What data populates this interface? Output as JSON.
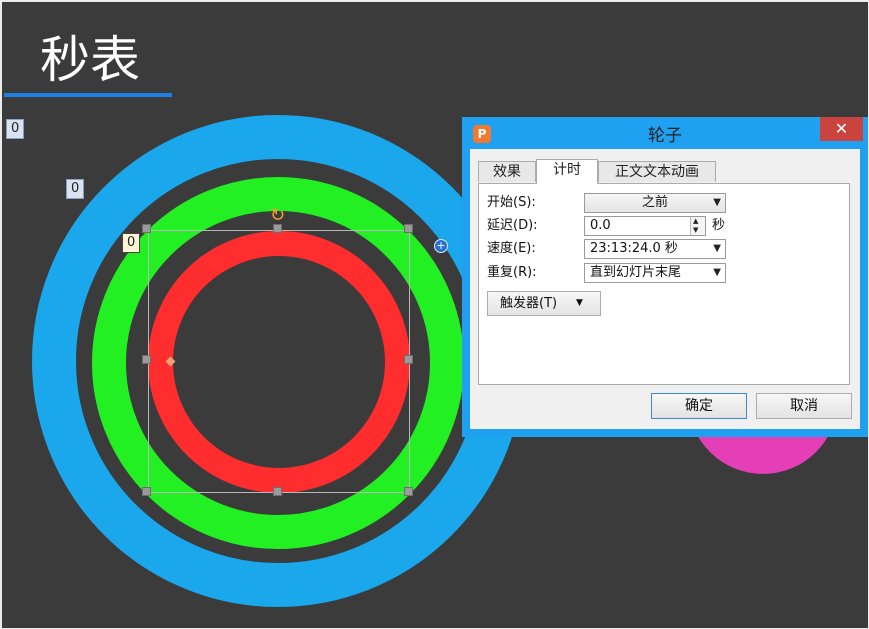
{
  "slide": {
    "title": "秒表",
    "animation_tags": [
      "0",
      "0",
      "0"
    ]
  },
  "colors": {
    "slide_background": "#3b3b3b",
    "title_underline": "#1f7fe0",
    "ring_outer": "#1aa7ec",
    "ring_middle": "#22f022",
    "ring_inner": "#ff2d2d",
    "pink_shape": "#e53fb8",
    "dialog_frame": "#1fa0f0",
    "close_button": "#c9443e"
  },
  "dialog": {
    "title": "轮子",
    "close_label": "✕",
    "app_icon_glyph": "P",
    "tabs": [
      {
        "label": "效果",
        "active": false
      },
      {
        "label": "计时",
        "active": true
      },
      {
        "label": "正文文本动画",
        "active": false
      }
    ],
    "fields": {
      "start": {
        "label": "开始(S):",
        "value": "之前"
      },
      "delay": {
        "label": "延迟(D):",
        "value": "0.0",
        "unit": "秒"
      },
      "speed": {
        "label": "速度(E):",
        "value": "23:13:24.0 秒"
      },
      "repeat": {
        "label": "重复(R):",
        "value": "直到幻灯片末尾"
      }
    },
    "trigger_label": "触发器(T)",
    "ok_label": "确定",
    "cancel_label": "取消"
  },
  "icons": {
    "dropdown": "▼",
    "spin_up": "▲",
    "spin_down": "▼",
    "trigger_arrow": "▼",
    "rotate": "↻",
    "plus": "+"
  }
}
